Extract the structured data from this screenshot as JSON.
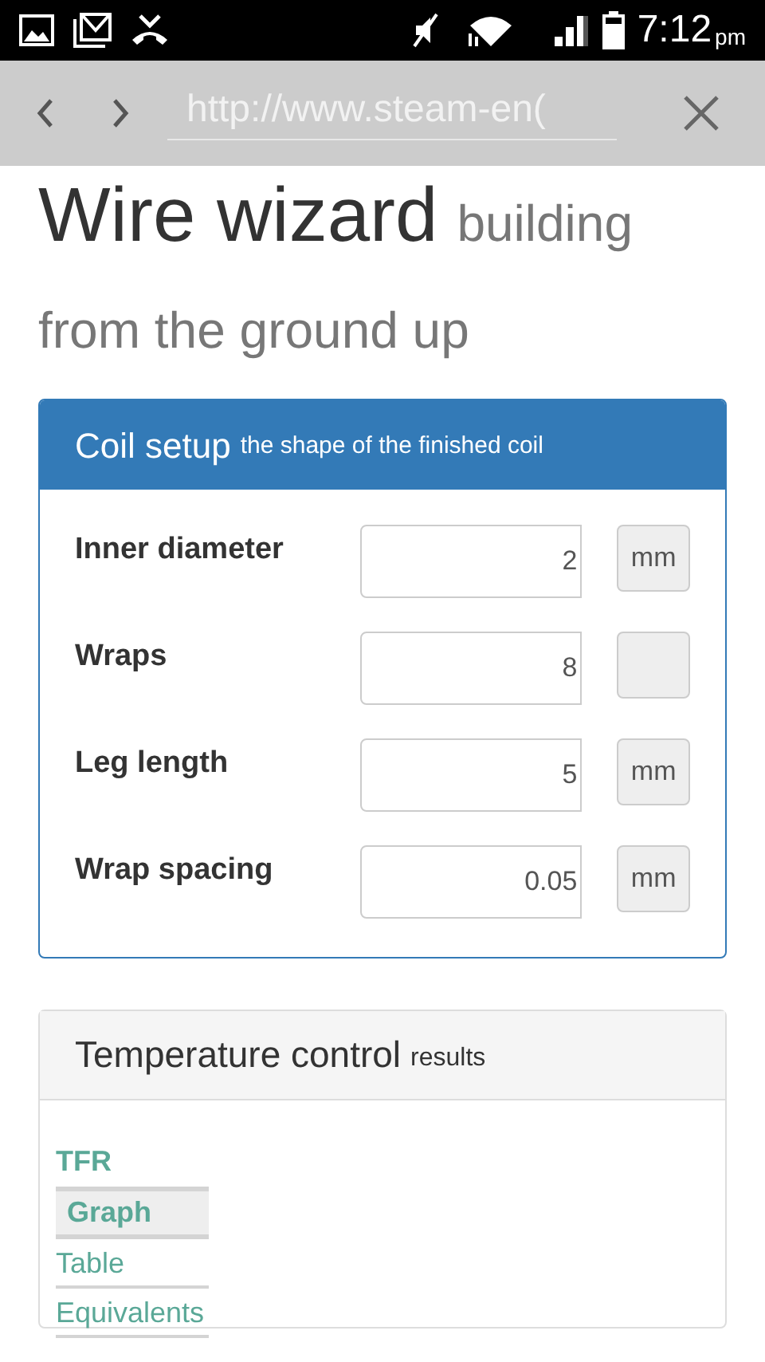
{
  "status_bar": {
    "time": "7:12",
    "ampm": "pm"
  },
  "browser": {
    "url": "http://www.steam-en("
  },
  "heading": {
    "title": "Wire wizard",
    "subtitle": "building from the ground up"
  },
  "coil_panel": {
    "title": "Coil setup",
    "subtitle": "the shape of the finished coil",
    "fields": [
      {
        "label": "Inner diameter",
        "value": "2",
        "unit": "mm"
      },
      {
        "label": "Wraps",
        "value": "8"
      },
      {
        "label": "Leg length",
        "value": "5",
        "unit": "mm"
      },
      {
        "label": "Wrap spacing",
        "value": "0.05",
        "unit": "mm"
      }
    ]
  },
  "results_panel": {
    "title": "Temperature control",
    "subtitle": "results",
    "group_title": "TFR",
    "tabs": [
      {
        "label": "Graph",
        "selected": true
      },
      {
        "label": "Table",
        "selected": false
      },
      {
        "label": "Equivalents",
        "selected": false
      }
    ]
  }
}
